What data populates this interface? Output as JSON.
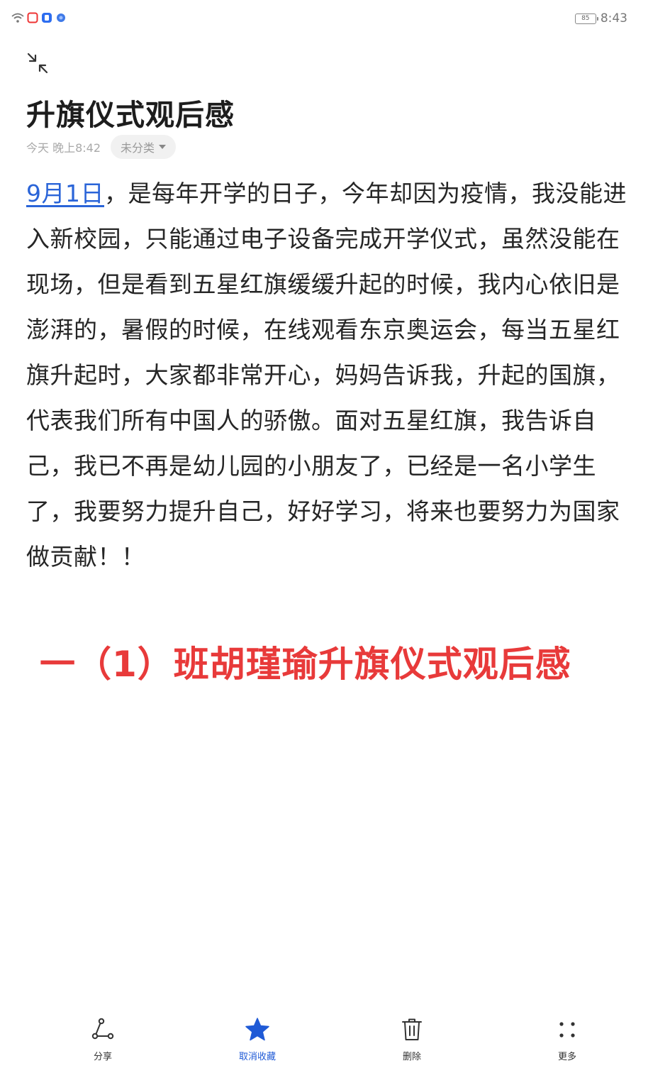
{
  "status_bar": {
    "battery_level": "85",
    "time": "8:43"
  },
  "note": {
    "title": "升旗仪式观后感",
    "timestamp": "今天 晚上8:42",
    "category": "未分类",
    "date_link_text": "9月1日",
    "body_text": "，是每年开学的日子，今年却因为疫情，我没能进入新校园，只能通过电子设备完成开学仪式，虽然没能在现场，但是看到五星红旗缓缓升起的时候，我内心依旧是澎湃的，暑假的时候，在线观看东京奥运会，每当五星红旗升起时，大家都非常开心，妈妈告诉我，升起的国旗，代表我们所有中国人的骄傲。面对五星红旗，我告诉自己，我已不再是幼儿园的小朋友了，已经是一名小学生了，我要努力提升自己，好好学习，将来也要努力为国家做贡献！！"
  },
  "caption": {
    "text": "一（1）班胡瑾瑜升旗仪式观后感",
    "color": "#e83a3a"
  },
  "toolbar": {
    "share_label": "分享",
    "unfavorite_label": "取消收藏",
    "delete_label": "删除",
    "more_label": "更多",
    "accent_color": "#1f5ad6"
  }
}
